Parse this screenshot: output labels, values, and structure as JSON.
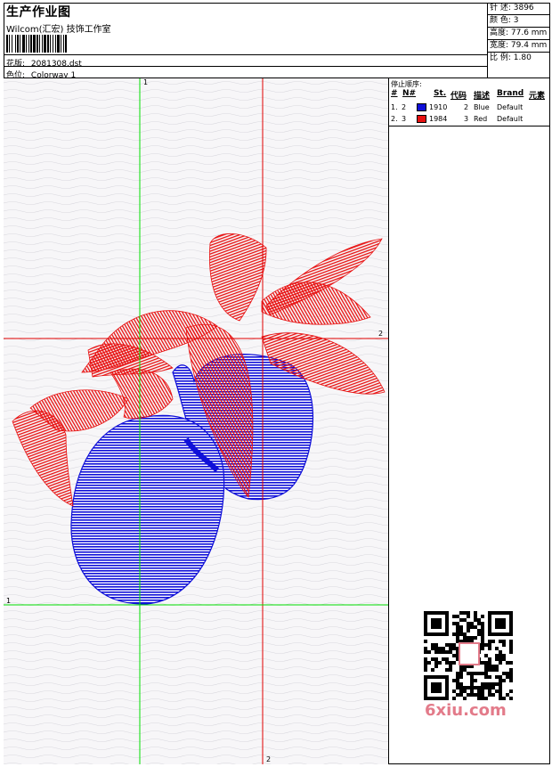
{
  "header": {
    "title": "生产作业图",
    "studio": "Wilcom(汇宏) 技饰工作室",
    "pattern_label": "花版:",
    "pattern_value": "2081308.dst",
    "colorway_label": "色位:",
    "colorway_value": "Colorway 1"
  },
  "stats": {
    "stitches": "针 述: 3896",
    "colors": "颜 色: 3",
    "height": "高度: 77.6 mm",
    "width": "宽度: 79.4 mm",
    "ratio": "比 例: 1.80"
  },
  "stop_sequence": {
    "title": "停止顺序:",
    "columns": [
      "#",
      "N#",
      "St.",
      "代码",
      "描述",
      "Brand",
      "元素"
    ],
    "rows": [
      {
        "idx": "1.",
        "n": "2",
        "color": "#1010d8",
        "stitches": "1910",
        "code": "2",
        "desc": "Blue",
        "brand": "Default"
      },
      {
        "idx": "2.",
        "n": "3",
        "color": "#e81010",
        "stitches": "1984",
        "code": "3",
        "desc": "Red",
        "brand": "Default"
      }
    ]
  },
  "guides": {
    "v1": "1",
    "v2": "2",
    "h1": "1",
    "h2": "2"
  },
  "colors": {
    "blue": "#1010d8",
    "red": "#e81010",
    "green_guide": "#00dd00",
    "red_guide": "#e00000"
  },
  "watermark": "6xiu.com"
}
